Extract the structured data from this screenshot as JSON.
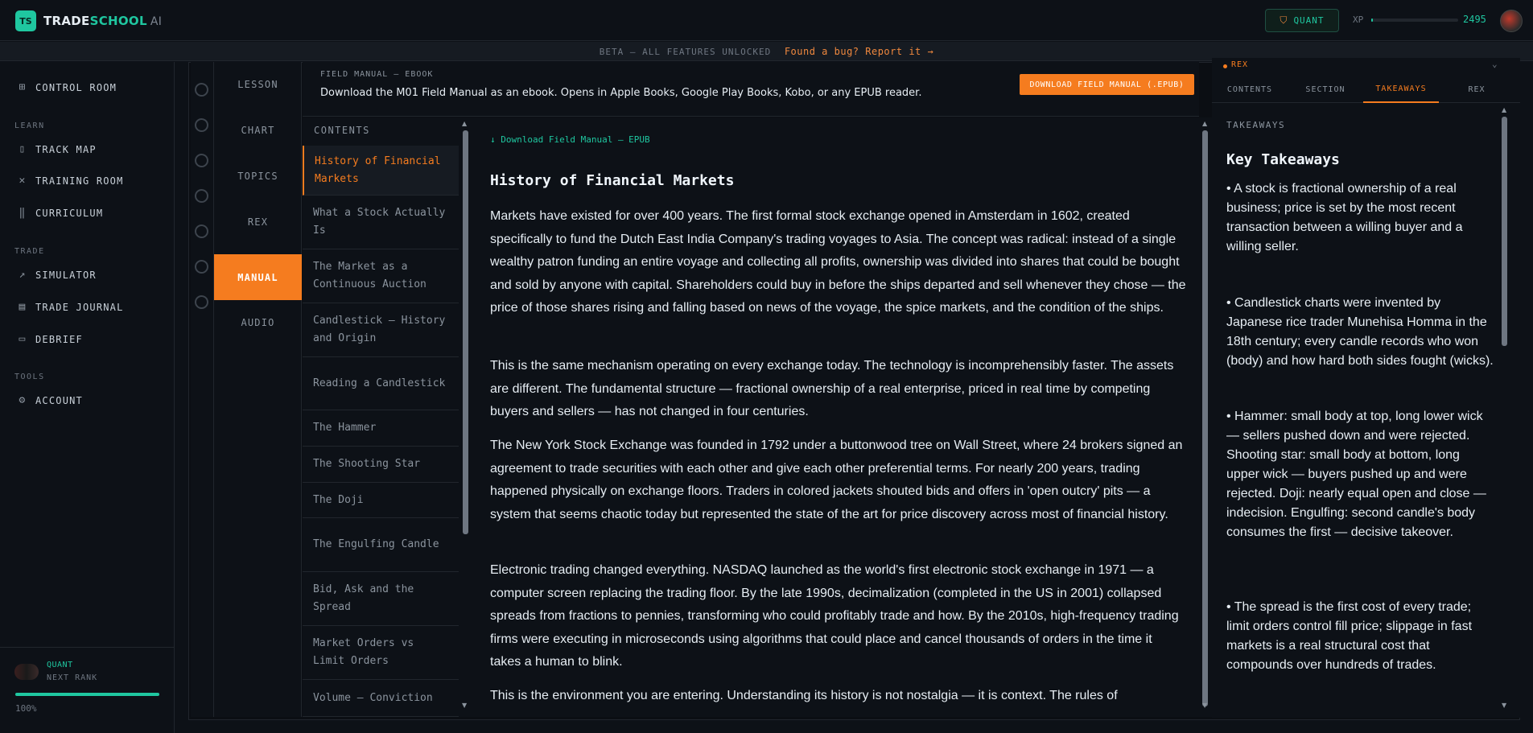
{
  "app": {
    "logo_badge": "TS",
    "name_trade": "TRADE",
    "name_school": "SCHOOL",
    "name_ai": "AI"
  },
  "header": {
    "rank_label": "QUANT",
    "xp_label": "XP",
    "xp_value": "2495",
    "xp_fraction": 0.02
  },
  "beta_bar": {
    "notice": "BETA — ALL FEATURES UNLOCKED",
    "report_link": "Found a bug? Report it →"
  },
  "sidebar": {
    "control_room": "CONTROL ROOM",
    "section_learn": "LEARN",
    "track_map": "TRACK MAP",
    "training_room": "TRAINING ROOM",
    "curriculum": "CURRICULUM",
    "section_trade": "TRADE",
    "simulator": "SIMULATOR",
    "trade_journal": "TRADE JOURNAL",
    "debrief": "DEBRIEF",
    "section_tools": "TOOLS",
    "account": "ACCOUNT",
    "footer": {
      "rank": "QUANT",
      "next_rank": "NEXT RANK",
      "progress_pct": "100%",
      "progress_fraction": 1.0
    }
  },
  "modes": {
    "lesson": "LESSON",
    "chart": "CHART",
    "topics": "TOPICS",
    "rex": "REX",
    "manual": "MANUAL",
    "audio": "AUDIO"
  },
  "manual": {
    "kicker": "FIELD MANUAL — EBOOK",
    "description": "Download the M01 Field Manual as an ebook. Opens in Apple Books, Google Play Books, Kobo, or any EPUB reader.",
    "download_button": "DOWNLOAD FIELD MANUAL (.EPUB)"
  },
  "toc": {
    "title": "CONTENTS",
    "items": [
      "History of Financial Markets",
      "What a Stock Actually Is",
      "The Market as a Continuous Auction",
      "Candlestick — History and Origin",
      "Reading a Candlestick",
      "The Hammer",
      "The Shooting Star",
      "The Doji",
      "The Engulfing Candle",
      "Bid, Ask and the Spread",
      "Market Orders vs Limit Orders",
      "Volume — Conviction"
    ]
  },
  "content": {
    "download_link": "↓ Download Field Manual — EPUB",
    "title": "History of Financial Markets",
    "paragraphs": [
      "Markets have existed for over 400 years. The first formal stock exchange opened in Amsterdam in 1602, created specifically to fund the Dutch East India Company's trading voyages to Asia. The concept was radical: instead of a single wealthy patron funding an entire voyage and collecting all profits, ownership was divided into shares that could be bought and sold by anyone with capital. Shareholders could buy in before the ships departed and sell whenever they chose — the price of those shares rising and falling based on news of the voyage, the spice markets, and the condition of the ships.",
      "This is the same mechanism operating on every exchange today. The technology is incomprehensibly faster. The assets are different. The fundamental structure — fractional ownership of a real enterprise, priced in real time by competing buyers and sellers — has not changed in four centuries.",
      "The New York Stock Exchange was founded in 1792 under a buttonwood tree on Wall Street, where 24 brokers signed an agreement to trade securities with each other and give each other preferential terms. For nearly 200 years, trading happened physically on exchange floors. Traders in colored jackets shouted bids and offers in 'open outcry' pits — a system that seems chaotic today but represented the state of the art for price discovery across most of financial history.",
      "Electronic trading changed everything. NASDAQ launched as the world's first electronic stock exchange in 1971 — a computer screen replacing the trading floor. By the late 1990s, decimalization (completed in the US in 2001) collapsed spreads from fractions to pennies, transforming who could profitably trade and how. By the 2010s, high-frequency trading firms were executing in microseconds using algorithms that could place and cancel thousands of orders in the time it takes a human to blink.",
      "This is the environment you are entering. Understanding its history is not nostalgia — it is context. The rules of"
    ]
  },
  "right_panel": {
    "assistant_name": "REX",
    "tabs": [
      "CONTENTS",
      "SECTION",
      "TAKEAWAYS",
      "REX"
    ],
    "active_tab": "TAKEAWAYS",
    "kicker": "TAKEAWAYS",
    "title": "Key Takeaways",
    "items": [
      "• A stock is fractional ownership of a real business; price is set by the most recent transaction between a willing buyer and a willing seller.",
      "• Candlestick charts were invented by Japanese rice trader Munehisa Homma in the 18th century; every candle records who won (body) and how hard both sides fought (wicks).",
      "• Hammer: small body at top, long lower wick — sellers pushed down and were rejected. Shooting star: small body at bottom, long upper wick — buyers pushed up and were rejected. Doji: nearly equal open and close — indecision. Engulfing: second candle's body consumes the first — decisive takeover.",
      "• The spread is the first cost of every trade; limit orders control fill price; slippage in fast markets is a real structural cost that compounds over hundreds of trades."
    ]
  }
}
